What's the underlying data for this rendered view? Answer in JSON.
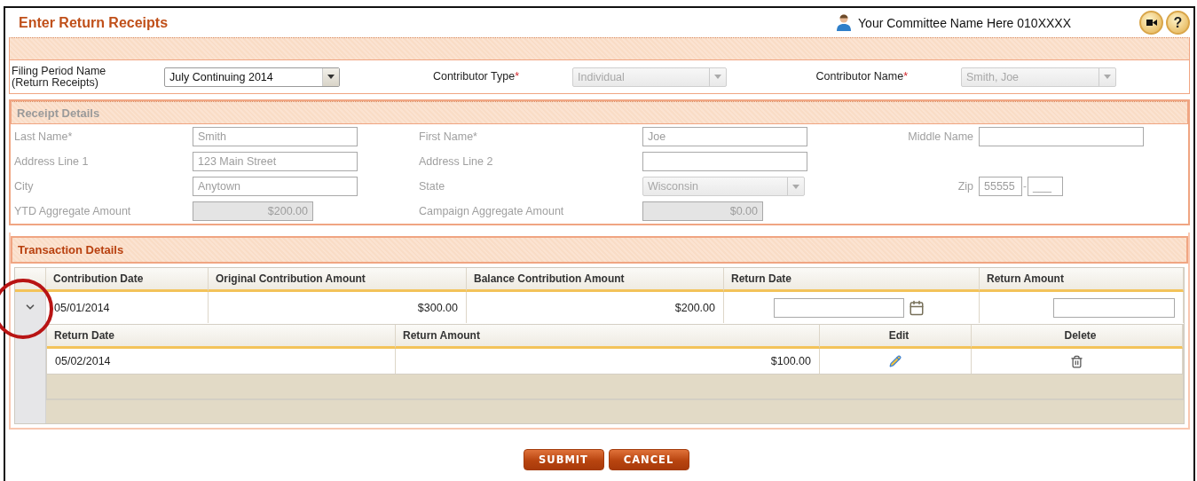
{
  "header": {
    "title": "Enter Return Receipts",
    "committee_name": "Your Committee Name Here 010XXXX",
    "help_label": "?"
  },
  "filing": {
    "fields": [
      {
        "label": "Filing Period Name\n(Return Receipts)",
        "kind": "select",
        "value": "July Continuing 2014",
        "disabled": false
      },
      {
        "label": "Contributor Type",
        "required_mark": "*",
        "kind": "select",
        "value": "Individual",
        "disabled": true
      },
      {
        "label": "Contributor Name",
        "required_mark": "*",
        "kind": "select",
        "value": "Smith, Joe",
        "disabled": true
      }
    ]
  },
  "receipt_details": {
    "title": "Receipt Details",
    "disabled": true,
    "rows": [
      [
        {
          "label": "Last Name*",
          "kind": "text",
          "value": "Smith"
        },
        {
          "label": "First Name*",
          "kind": "text",
          "value": "Joe"
        },
        {
          "label": "Middle Name",
          "kind": "text"
        }
      ],
      [
        {
          "label": "Address Line 1",
          "kind": "text",
          "value": "123 Main Street"
        },
        {
          "label": "Address Line 2",
          "kind": "text"
        }
      ],
      [
        {
          "label": "City",
          "kind": "text",
          "value": "Anytown"
        },
        {
          "label": "State",
          "kind": "select",
          "value": "Wisconsin"
        },
        {
          "label": "Zip",
          "kind": "zip",
          "value": "55555",
          "separator": "-",
          "placeholder": "___"
        }
      ],
      [
        {
          "label": "YTD Aggregate Amount",
          "kind": "amount",
          "value": "$200.00"
        },
        {
          "label": "Campaign Aggregate Amount",
          "kind": "amount",
          "value": "$0.00"
        }
      ]
    ]
  },
  "transaction_details": {
    "title": "Transaction Details",
    "columns": [
      "Contribution Date",
      "Original Contribution Amount",
      "Balance Contribution Amount",
      "Return Date",
      "Return Amount"
    ],
    "rows": [
      {
        "expanded": true,
        "contribution_date": "05/01/2014",
        "original_amount": "$300.00",
        "balance_amount": "$200.00",
        "returns": {
          "columns": [
            "Return Date",
            "Return Amount",
            "Edit",
            "Delete"
          ],
          "rows": [
            {
              "return_date": "05/02/2014",
              "return_amount": "$100.00"
            }
          ]
        }
      }
    ]
  },
  "buttons": [
    "SUBMIT",
    "CANCEL"
  ],
  "annotations": [
    {
      "kind": "circle"
    }
  ]
}
